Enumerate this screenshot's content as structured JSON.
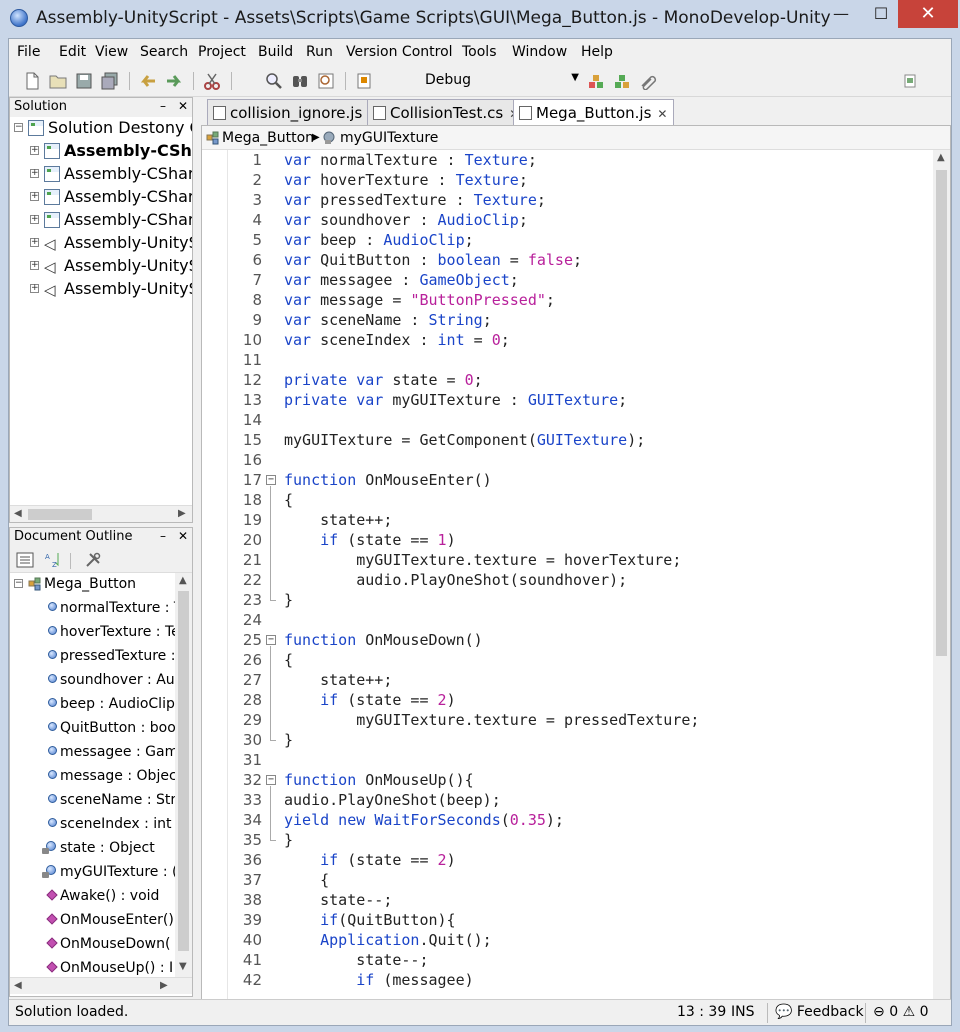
{
  "window": {
    "title": "Assembly-UnityScript - Assets\\Scripts\\Game Scripts\\GUI\\Mega_Button.js - MonoDevelop-Unity",
    "minimize": "—",
    "maximize": "☐",
    "close": "✕"
  },
  "menu": [
    "File",
    "Edit",
    "View",
    "Search",
    "Project",
    "Build",
    "Run",
    "Version Control",
    "Tools",
    "Window",
    "Help"
  ],
  "toolbar": {
    "configuration": "Debug"
  },
  "solution_pad": {
    "title": "Solution",
    "root": "Solution Destony Ga",
    "projects": [
      {
        "label": "Assembly-CShar",
        "bold": true,
        "icon": "csharp-project-icon"
      },
      {
        "label": "Assembly-CSharp",
        "bold": false,
        "icon": "csharp-project-icon"
      },
      {
        "label": "Assembly-CSharp",
        "bold": false,
        "icon": "csharp-project-icon"
      },
      {
        "label": "Assembly-CSharp",
        "bold": false,
        "icon": "csharp-project-icon"
      },
      {
        "label": "Assembly-UnitySc",
        "bold": false,
        "icon": "unity-project-icon"
      },
      {
        "label": "Assembly-UnitySc",
        "bold": false,
        "icon": "unity-project-icon"
      },
      {
        "label": "Assembly-UnitySc",
        "bold": false,
        "icon": "unity-project-icon"
      }
    ]
  },
  "outline_pad": {
    "title": "Document Outline",
    "root": "Mega_Button",
    "members": [
      {
        "label": "normalTexture : T",
        "kind": "field"
      },
      {
        "label": "hoverTexture : Te",
        "kind": "field"
      },
      {
        "label": "pressedTexture :",
        "kind": "field"
      },
      {
        "label": "soundhover : Auc",
        "kind": "field"
      },
      {
        "label": "beep : AudioClip",
        "kind": "field"
      },
      {
        "label": "QuitButton : boo",
        "kind": "field"
      },
      {
        "label": "messagee : Game",
        "kind": "field"
      },
      {
        "label": "message : Objec",
        "kind": "field"
      },
      {
        "label": "sceneName : Stri",
        "kind": "field"
      },
      {
        "label": "sceneIndex : int",
        "kind": "field"
      },
      {
        "label": "state : Object",
        "kind": "private"
      },
      {
        "label": "myGUITexture : (",
        "kind": "private"
      },
      {
        "label": "Awake() : void",
        "kind": "method"
      },
      {
        "label": "OnMouseEnter()",
        "kind": "method"
      },
      {
        "label": "OnMouseDown(",
        "kind": "method"
      },
      {
        "label": "OnMouseUp() : I",
        "kind": "method"
      }
    ]
  },
  "tabs": [
    {
      "label": "collision_ignore.js",
      "active": false
    },
    {
      "label": "CollisionTest.cs",
      "active": false
    },
    {
      "label": "Mega_Button.js",
      "active": true
    }
  ],
  "pathbar": {
    "class": "Mega_Button",
    "member": "myGUITexture"
  },
  "code": [
    {
      "n": "1",
      "tokens": [
        [
          "kw",
          "var"
        ],
        [
          "idt",
          " normalTexture : "
        ],
        [
          "ty",
          "Texture"
        ],
        [
          "idt",
          ";"
        ]
      ]
    },
    {
      "n": "2",
      "tokens": [
        [
          "kw",
          "var"
        ],
        [
          "idt",
          " hoverTexture : "
        ],
        [
          "ty",
          "Texture"
        ],
        [
          "idt",
          ";"
        ]
      ]
    },
    {
      "n": "3",
      "tokens": [
        [
          "kw",
          "var"
        ],
        [
          "idt",
          " pressedTexture : "
        ],
        [
          "ty",
          "Texture"
        ],
        [
          "idt",
          ";"
        ]
      ]
    },
    {
      "n": "4",
      "tokens": [
        [
          "kw",
          "var"
        ],
        [
          "idt",
          " soundhover : "
        ],
        [
          "ty",
          "AudioClip"
        ],
        [
          "idt",
          ";"
        ]
      ]
    },
    {
      "n": "5",
      "tokens": [
        [
          "kw",
          "var"
        ],
        [
          "idt",
          " beep : "
        ],
        [
          "ty",
          "AudioClip"
        ],
        [
          "idt",
          ";"
        ]
      ]
    },
    {
      "n": "6",
      "tokens": [
        [
          "kw",
          "var"
        ],
        [
          "idt",
          " QuitButton : "
        ],
        [
          "ty",
          "boolean"
        ],
        [
          "idt",
          " = "
        ],
        [
          "num",
          "false"
        ],
        [
          "idt",
          ";"
        ]
      ]
    },
    {
      "n": "7",
      "tokens": [
        [
          "kw",
          "var"
        ],
        [
          "idt",
          " messagee : "
        ],
        [
          "ty",
          "GameObject"
        ],
        [
          "idt",
          ";"
        ]
      ]
    },
    {
      "n": "8",
      "tokens": [
        [
          "kw",
          "var"
        ],
        [
          "idt",
          " message = "
        ],
        [
          "str",
          "\"ButtonPressed\""
        ],
        [
          "idt",
          ";"
        ]
      ]
    },
    {
      "n": "9",
      "tokens": [
        [
          "kw",
          "var"
        ],
        [
          "idt",
          " sceneName : "
        ],
        [
          "ty",
          "String"
        ],
        [
          "idt",
          ";"
        ]
      ]
    },
    {
      "n": "10",
      "tokens": [
        [
          "kw",
          "var"
        ],
        [
          "idt",
          " sceneIndex : "
        ],
        [
          "ty",
          "int"
        ],
        [
          "idt",
          " = "
        ],
        [
          "num",
          "0"
        ],
        [
          "idt",
          ";"
        ]
      ]
    },
    {
      "n": "11",
      "tokens": []
    },
    {
      "n": "12",
      "tokens": [
        [
          "kw",
          "private var"
        ],
        [
          "idt",
          " state = "
        ],
        [
          "num",
          "0"
        ],
        [
          "idt",
          ";"
        ]
      ]
    },
    {
      "n": "13",
      "tokens": [
        [
          "kw",
          "private var"
        ],
        [
          "idt",
          " myGUITexture : "
        ],
        [
          "ty",
          "GUITexture"
        ],
        [
          "idt",
          ";"
        ]
      ]
    },
    {
      "n": "14",
      "tokens": []
    },
    {
      "n": "15",
      "tokens": [
        [
          "idt",
          "myGUITexture = GetComponent("
        ],
        [
          "ty",
          "GUITexture"
        ],
        [
          "idt",
          ");"
        ]
      ]
    },
    {
      "n": "16",
      "tokens": []
    },
    {
      "n": "17",
      "tokens": [
        [
          "kw",
          "function"
        ],
        [
          "idt",
          " OnMouseEnter()"
        ]
      ],
      "fold": "start"
    },
    {
      "n": "18",
      "tokens": [
        [
          "idt",
          "{"
        ]
      ]
    },
    {
      "n": "19",
      "tokens": [
        [
          "idt",
          "    state++;"
        ]
      ]
    },
    {
      "n": "20",
      "tokens": [
        [
          "idt",
          "    "
        ],
        [
          "kw",
          "if"
        ],
        [
          "idt",
          " (state == "
        ],
        [
          "num",
          "1"
        ],
        [
          "idt",
          ")"
        ]
      ]
    },
    {
      "n": "21",
      "tokens": [
        [
          "idt",
          "        myGUITexture.texture = hoverTexture;"
        ]
      ]
    },
    {
      "n": "22",
      "tokens": [
        [
          "idt",
          "        audio.PlayOneShot(soundhover);"
        ]
      ]
    },
    {
      "n": "23",
      "tokens": [
        [
          "idt",
          "}"
        ]
      ],
      "fold": "end"
    },
    {
      "n": "24",
      "tokens": []
    },
    {
      "n": "25",
      "tokens": [
        [
          "kw",
          "function"
        ],
        [
          "idt",
          " OnMouseDown()"
        ]
      ],
      "fold": "start"
    },
    {
      "n": "26",
      "tokens": [
        [
          "idt",
          "{"
        ]
      ]
    },
    {
      "n": "27",
      "tokens": [
        [
          "idt",
          "    state++;"
        ]
      ]
    },
    {
      "n": "28",
      "tokens": [
        [
          "idt",
          "    "
        ],
        [
          "kw",
          "if"
        ],
        [
          "idt",
          " (state == "
        ],
        [
          "num",
          "2"
        ],
        [
          "idt",
          ")"
        ]
      ]
    },
    {
      "n": "29",
      "tokens": [
        [
          "idt",
          "        myGUITexture.texture = pressedTexture;"
        ]
      ]
    },
    {
      "n": "30",
      "tokens": [
        [
          "idt",
          "}"
        ]
      ],
      "fold": "end"
    },
    {
      "n": "31",
      "tokens": []
    },
    {
      "n": "32",
      "tokens": [
        [
          "kw",
          "function"
        ],
        [
          "idt",
          " OnMouseUp(){"
        ]
      ],
      "fold": "start"
    },
    {
      "n": "33",
      "tokens": [
        [
          "idt",
          "audio.PlayOneShot(beep);"
        ]
      ]
    },
    {
      "n": "34",
      "tokens": [
        [
          "kw",
          "yield new"
        ],
        [
          "idt",
          " "
        ],
        [
          "ty",
          "WaitForSeconds"
        ],
        [
          "idt",
          "("
        ],
        [
          "num",
          "0.35"
        ],
        [
          "idt",
          ");"
        ]
      ]
    },
    {
      "n": "35",
      "tokens": [
        [
          "idt",
          "}"
        ]
      ],
      "fold": "end"
    },
    {
      "n": "36",
      "tokens": [
        [
          "idt",
          "    "
        ],
        [
          "kw",
          "if"
        ],
        [
          "idt",
          " (state == "
        ],
        [
          "num",
          "2"
        ],
        [
          "idt",
          ")"
        ]
      ]
    },
    {
      "n": "37",
      "tokens": [
        [
          "idt",
          "    {"
        ]
      ]
    },
    {
      "n": "38",
      "tokens": [
        [
          "idt",
          "    state--;"
        ]
      ]
    },
    {
      "n": "39",
      "tokens": [
        [
          "idt",
          "    "
        ],
        [
          "kw",
          "if"
        ],
        [
          "idt",
          "(QuitButton){"
        ]
      ]
    },
    {
      "n": "40",
      "tokens": [
        [
          "idt",
          "    "
        ],
        [
          "ty",
          "Application"
        ],
        [
          "idt",
          ".Quit();"
        ]
      ]
    },
    {
      "n": "41",
      "tokens": [
        [
          "idt",
          "        state--;"
        ]
      ]
    },
    {
      "n": "42",
      "tokens": [
        [
          "idt",
          "        "
        ],
        [
          "kw",
          "if"
        ],
        [
          "idt",
          " (messagee)"
        ]
      ]
    }
  ],
  "status": {
    "message": "Solution loaded.",
    "position": "13 : 39",
    "mode": "INS",
    "feedback": "Feedback",
    "errors": "0",
    "warnings": "0"
  }
}
